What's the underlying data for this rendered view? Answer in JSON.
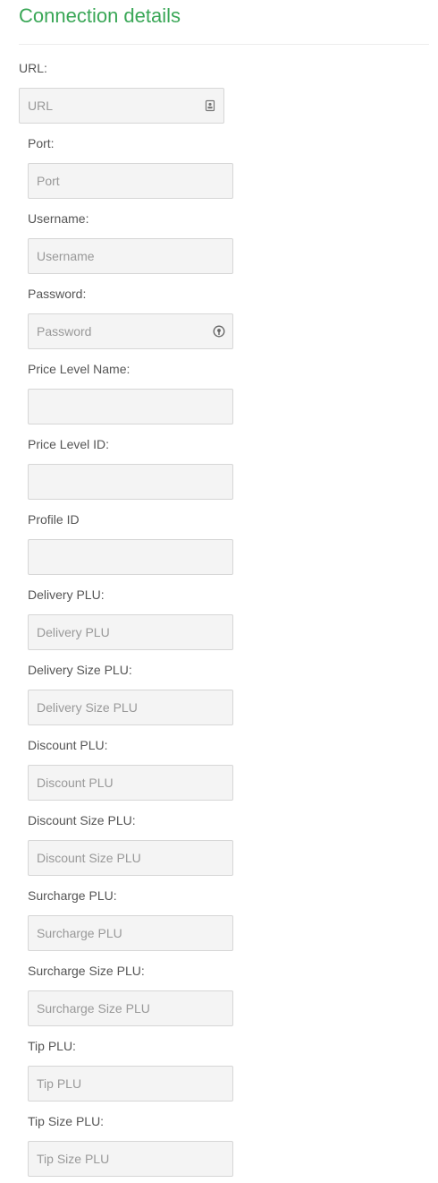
{
  "section": {
    "title": "Connection details"
  },
  "fields": {
    "url": {
      "label": "URL:",
      "placeholder": "URL",
      "value": "",
      "icon": "contact-card-icon"
    },
    "port": {
      "label": "Port:",
      "placeholder": "Port",
      "value": ""
    },
    "username": {
      "label": "Username:",
      "placeholder": "Username",
      "value": ""
    },
    "password": {
      "label": "Password:",
      "placeholder": "Password",
      "value": "",
      "icon": "password-key-icon"
    },
    "price_level_name": {
      "label": "Price Level Name:",
      "placeholder": "",
      "value": ""
    },
    "price_level_id": {
      "label": "Price Level ID:",
      "placeholder": "",
      "value": ""
    },
    "profile_id": {
      "label": "Profile ID",
      "placeholder": "",
      "value": ""
    },
    "delivery_plu": {
      "label": "Delivery PLU:",
      "placeholder": "Delivery PLU",
      "value": ""
    },
    "delivery_size_plu": {
      "label": "Delivery Size PLU:",
      "placeholder": "Delivery Size PLU",
      "value": ""
    },
    "discount_plu": {
      "label": "Discount PLU:",
      "placeholder": "Discount PLU",
      "value": ""
    },
    "discount_size_plu": {
      "label": "Discount Size PLU:",
      "placeholder": "Discount Size PLU",
      "value": ""
    },
    "surcharge_plu": {
      "label": "Surcharge PLU:",
      "placeholder": "Surcharge PLU",
      "value": ""
    },
    "surcharge_size_plu": {
      "label": "Surcharge Size PLU:",
      "placeholder": "Surcharge Size PLU",
      "value": ""
    },
    "tip_plu": {
      "label": "Tip PLU:",
      "placeholder": "Tip PLU",
      "value": ""
    },
    "tip_size_plu": {
      "label": "Tip Size PLU:",
      "placeholder": "Tip Size PLU",
      "value": ""
    }
  },
  "colors": {
    "accent": "#3aa757",
    "label": "#555555",
    "input_bg": "#f4f4f4",
    "input_border": "#d6d6d6",
    "placeholder": "#999999"
  }
}
